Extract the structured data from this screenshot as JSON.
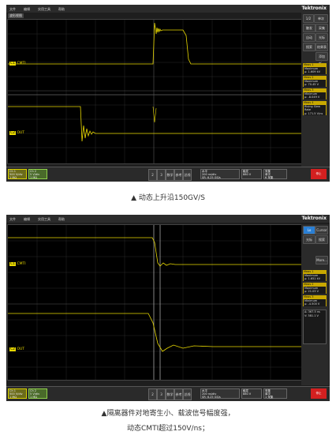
{
  "screenshot1": {
    "brand": "Tektronix",
    "menu": [
      "文件",
      "编辑",
      "实用工具",
      "帮助"
    ],
    "waveform_title": "波形视图",
    "channel_labels": {
      "cmti": "CMTI",
      "out": "OUT"
    },
    "side": {
      "run_stop": "单次",
      "buttons": [
        "触发",
        "采集",
        "自动",
        "光标",
        "搜索",
        "结果表格",
        "添加新..."
      ],
      "measurements": [
        {
          "title": "Meas 1",
          "l1": "Maximum",
          "l2": "μ: 1.609 kV"
        },
        {
          "title": "Meas 2",
          "l1": "Maximum",
          "l2": "μ: 70.45 V"
        },
        {
          "title": "Meas 3",
          "l1": "Minimum",
          "l2": "μ: -8.049 V"
        },
        {
          "title": "Meas 4",
          "l1": "Rising Slew Rate",
          "l2": "μ: 171.5 V/ns"
        }
      ]
    },
    "bottom": {
      "ch1": [
        "Ch 1",
        "500 V/div",
        "1 MΩ",
        "500 MHz"
      ],
      "ch2": [
        "Ch 2",
        "5 V/div",
        "1 MΩ",
        "350 MHz"
      ],
      "tabs": [
        "2",
        "3",
        "数学",
        "参考",
        "总线"
      ],
      "horizontal": [
        "水平",
        "200 ns/div",
        "SR: 6.25 GS/s",
        "RL: 12.5 kpts"
      ],
      "trigger": [
        "触发",
        "880 V"
      ],
      "acq": [
        "采集",
        "单次",
        "高分辨",
        "6 采集"
      ],
      "stop": "停止"
    },
    "caption": "▲ 动态上升沿150GV/S"
  },
  "screenshot2": {
    "brand": "Tektronix",
    "menu": [
      "文件",
      "编辑",
      "实用工具",
      "帮助"
    ],
    "channel_labels": {
      "cmti": "CMTI",
      "out": "OUT"
    },
    "side": {
      "buttons": [
        "Lo",
        "Cursor",
        "光标",
        "搜索",
        "More..."
      ],
      "measurements": [
        {
          "title": "Meas 1",
          "l1": "Maximum",
          "l2": "μ: 1.651 kV"
        },
        {
          "title": "Meas 2",
          "l1": "Maximum",
          "l2": "μ: 21.03 V"
        },
        {
          "title": "Meas 3",
          "l1": "Minimum",
          "l2": "μ: -4.500 V"
        },
        {
          "title": "Meas 4",
          "l1": "",
          "l2": ""
        }
      ],
      "cursor_readout": [
        "Δ: 367.5 ns",
        "V: 381.1 V"
      ]
    },
    "bottom": {
      "ch1": [
        "Ch 1",
        "500 V/div",
        "1 MΩ",
        "500 MHz"
      ],
      "ch2": [
        "Ch 2",
        "5 V/div",
        "1 MΩ",
        "350 MHz"
      ],
      "tabs": [
        "2",
        "3",
        "数学",
        "参考",
        "总线"
      ],
      "horizontal": [
        "水平",
        "200 ns/div",
        "SR: 6.25 GS/s",
        "RL: 12.5 kpts"
      ],
      "trigger": [
        "触发",
        "880 V"
      ],
      "acq": [
        "采集",
        "单次",
        "高分辨",
        "1 采集"
      ],
      "stop": "停止"
    },
    "caption_line1": "▲隔离器件对地寄生小、载波信号幅度强，",
    "caption_line2": "动态CMTI超过150V/ns；"
  }
}
